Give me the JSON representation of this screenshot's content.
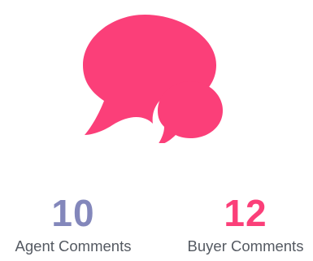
{
  "icon": {
    "name": "comments-icon",
    "color": "#fb3f79"
  },
  "stats": [
    {
      "count": "10",
      "label": "Agent Comments",
      "color": "#8387bb"
    },
    {
      "count": "12",
      "label": "Buyer Comments",
      "color": "#fb3f79"
    }
  ]
}
